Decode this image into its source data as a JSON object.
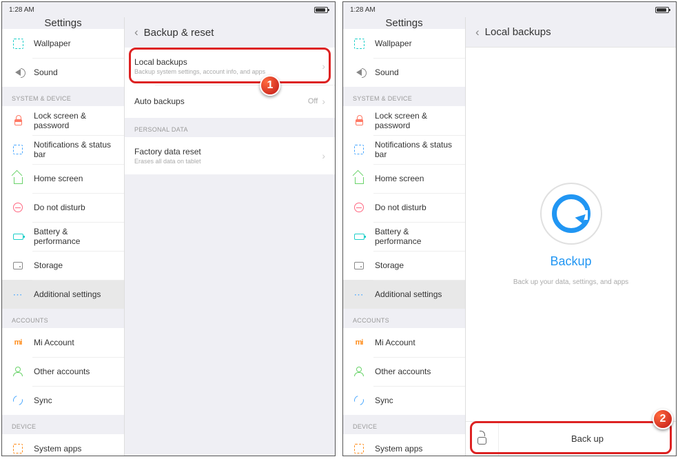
{
  "statusbar": {
    "time": "1:28 AM"
  },
  "sidebar": {
    "title": "Settings",
    "items_top": [
      {
        "key": "wallpaper",
        "label": "Wallpaper"
      },
      {
        "key": "sound",
        "label": "Sound"
      }
    ],
    "section_system": "SYSTEM & DEVICE",
    "items_system": [
      {
        "key": "lock",
        "label": "Lock screen & password"
      },
      {
        "key": "notif",
        "label": "Notifications & status bar"
      },
      {
        "key": "home",
        "label": "Home screen"
      },
      {
        "key": "dnd",
        "label": "Do not disturb"
      },
      {
        "key": "battery",
        "label": "Battery & performance"
      },
      {
        "key": "storage",
        "label": "Storage"
      },
      {
        "key": "additional",
        "label": "Additional settings",
        "selected": true
      }
    ],
    "section_accounts": "ACCOUNTS",
    "items_accounts": [
      {
        "key": "mi",
        "label": "Mi Account"
      },
      {
        "key": "other",
        "label": "Other accounts"
      },
      {
        "key": "sync",
        "label": "Sync"
      }
    ],
    "section_device": "DEVICE",
    "items_device": [
      {
        "key": "sysapps",
        "label": "System apps"
      }
    ]
  },
  "screen1": {
    "title": "Backup & reset",
    "local_backups": {
      "title": "Local backups",
      "subtitle": "Backup system settings, account info, and apps"
    },
    "auto_backups": {
      "title": "Auto backups",
      "value": "Off"
    },
    "section_personal": "PERSONAL DATA",
    "factory_reset": {
      "title": "Factory data reset",
      "subtitle": "Erases all data on tablet"
    },
    "callout_num": "1"
  },
  "screen2": {
    "title": "Local backups",
    "backup_heading": "Backup",
    "backup_sub": "Back up your data, settings, and apps",
    "backup_button": "Back up",
    "callout_num": "2"
  }
}
